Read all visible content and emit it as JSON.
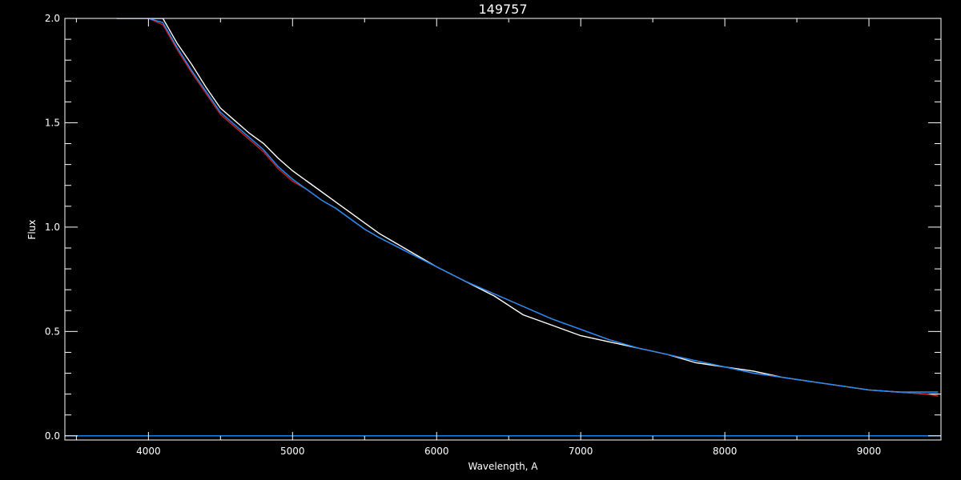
{
  "chart_data": {
    "type": "line",
    "title": "149757",
    "xlabel": "Wavelength, A",
    "ylabel": "Flux",
    "xlim": [
      3420,
      9500
    ],
    "ylim": [
      -0.02,
      2.0
    ],
    "x_ticks": [
      4000,
      5000,
      6000,
      7000,
      8000,
      9000
    ],
    "x_tick_labels": [
      "4000",
      "5000",
      "6000",
      "7000",
      "8000",
      "9000"
    ],
    "y_ticks": [
      0.0,
      0.5,
      1.0,
      1.5,
      2.0
    ],
    "y_tick_labels": [
      "0.0",
      "0.5",
      "1.0",
      "1.5",
      "2.0"
    ],
    "grid": false,
    "background": "#000000",
    "axis_color": "#ffffff",
    "series": [
      {
        "color": "#ffffff",
        "x": [
          3780,
          3900,
          4000,
          4100,
          4200,
          4300,
          4400,
          4500,
          4600,
          4700,
          4800,
          4900,
          5000,
          5100,
          5200,
          5300,
          5400,
          5500,
          5600,
          5800,
          6000,
          6200,
          6400,
          6600,
          6800,
          7000,
          7200,
          7400,
          7600,
          7800,
          8000,
          8200,
          8400,
          8600,
          8800,
          9000,
          9200,
          9400,
          9480
        ],
        "y": [
          2.0,
          2.0,
          2.0,
          2.0,
          1.88,
          1.78,
          1.67,
          1.57,
          1.51,
          1.45,
          1.4,
          1.33,
          1.27,
          1.22,
          1.17,
          1.12,
          1.07,
          1.02,
          0.97,
          0.89,
          0.81,
          0.74,
          0.67,
          0.58,
          0.53,
          0.48,
          0.45,
          0.42,
          0.39,
          0.35,
          0.33,
          0.31,
          0.28,
          0.26,
          0.24,
          0.22,
          0.21,
          0.2,
          0.2
        ]
      },
      {
        "color": "#cc2222",
        "x": [
          3780,
          3900,
          4000,
          4100,
          4200,
          4300,
          4400,
          4500,
          4600,
          4700,
          4800,
          4900,
          5000,
          5100,
          5200,
          5300,
          5400,
          5500,
          5600,
          5800,
          6000,
          6200,
          6400,
          6600,
          6800,
          7000,
          7200,
          7400,
          7600,
          7800,
          8000,
          8200,
          8400,
          8600,
          8800,
          9000,
          9200,
          9400,
          9480
        ],
        "y": [
          2.0,
          2.0,
          2.0,
          1.97,
          1.85,
          1.74,
          1.64,
          1.54,
          1.48,
          1.42,
          1.36,
          1.28,
          1.22,
          1.18,
          1.13,
          1.09,
          1.04,
          0.99,
          0.95,
          0.88,
          0.81,
          0.74,
          0.68,
          0.62,
          0.56,
          0.51,
          0.46,
          0.42,
          0.39,
          0.36,
          0.33,
          0.3,
          0.28,
          0.26,
          0.24,
          0.22,
          0.21,
          0.2,
          0.19
        ]
      },
      {
        "color": "#1e90ff",
        "x": [
          3780,
          3900,
          4000,
          4100,
          4200,
          4300,
          4400,
          4500,
          4600,
          4700,
          4800,
          4900,
          5000,
          5100,
          5200,
          5300,
          5400,
          5500,
          5600,
          5800,
          6000,
          6200,
          6400,
          6600,
          6800,
          7000,
          7200,
          7400,
          7600,
          7800,
          8000,
          8200,
          8400,
          8600,
          8800,
          9000,
          9200,
          9400,
          9480
        ],
        "y": [
          2.0,
          2.0,
          2.0,
          1.98,
          1.86,
          1.75,
          1.65,
          1.55,
          1.49,
          1.43,
          1.37,
          1.29,
          1.23,
          1.18,
          1.13,
          1.09,
          1.04,
          0.99,
          0.95,
          0.88,
          0.81,
          0.74,
          0.68,
          0.62,
          0.56,
          0.51,
          0.46,
          0.42,
          0.39,
          0.36,
          0.33,
          0.3,
          0.28,
          0.26,
          0.24,
          0.22,
          0.21,
          0.21,
          0.21
        ]
      },
      {
        "color": "#1e90ff",
        "x": [
          3420,
          9500
        ],
        "y": [
          0.0,
          0.0
        ]
      }
    ]
  }
}
